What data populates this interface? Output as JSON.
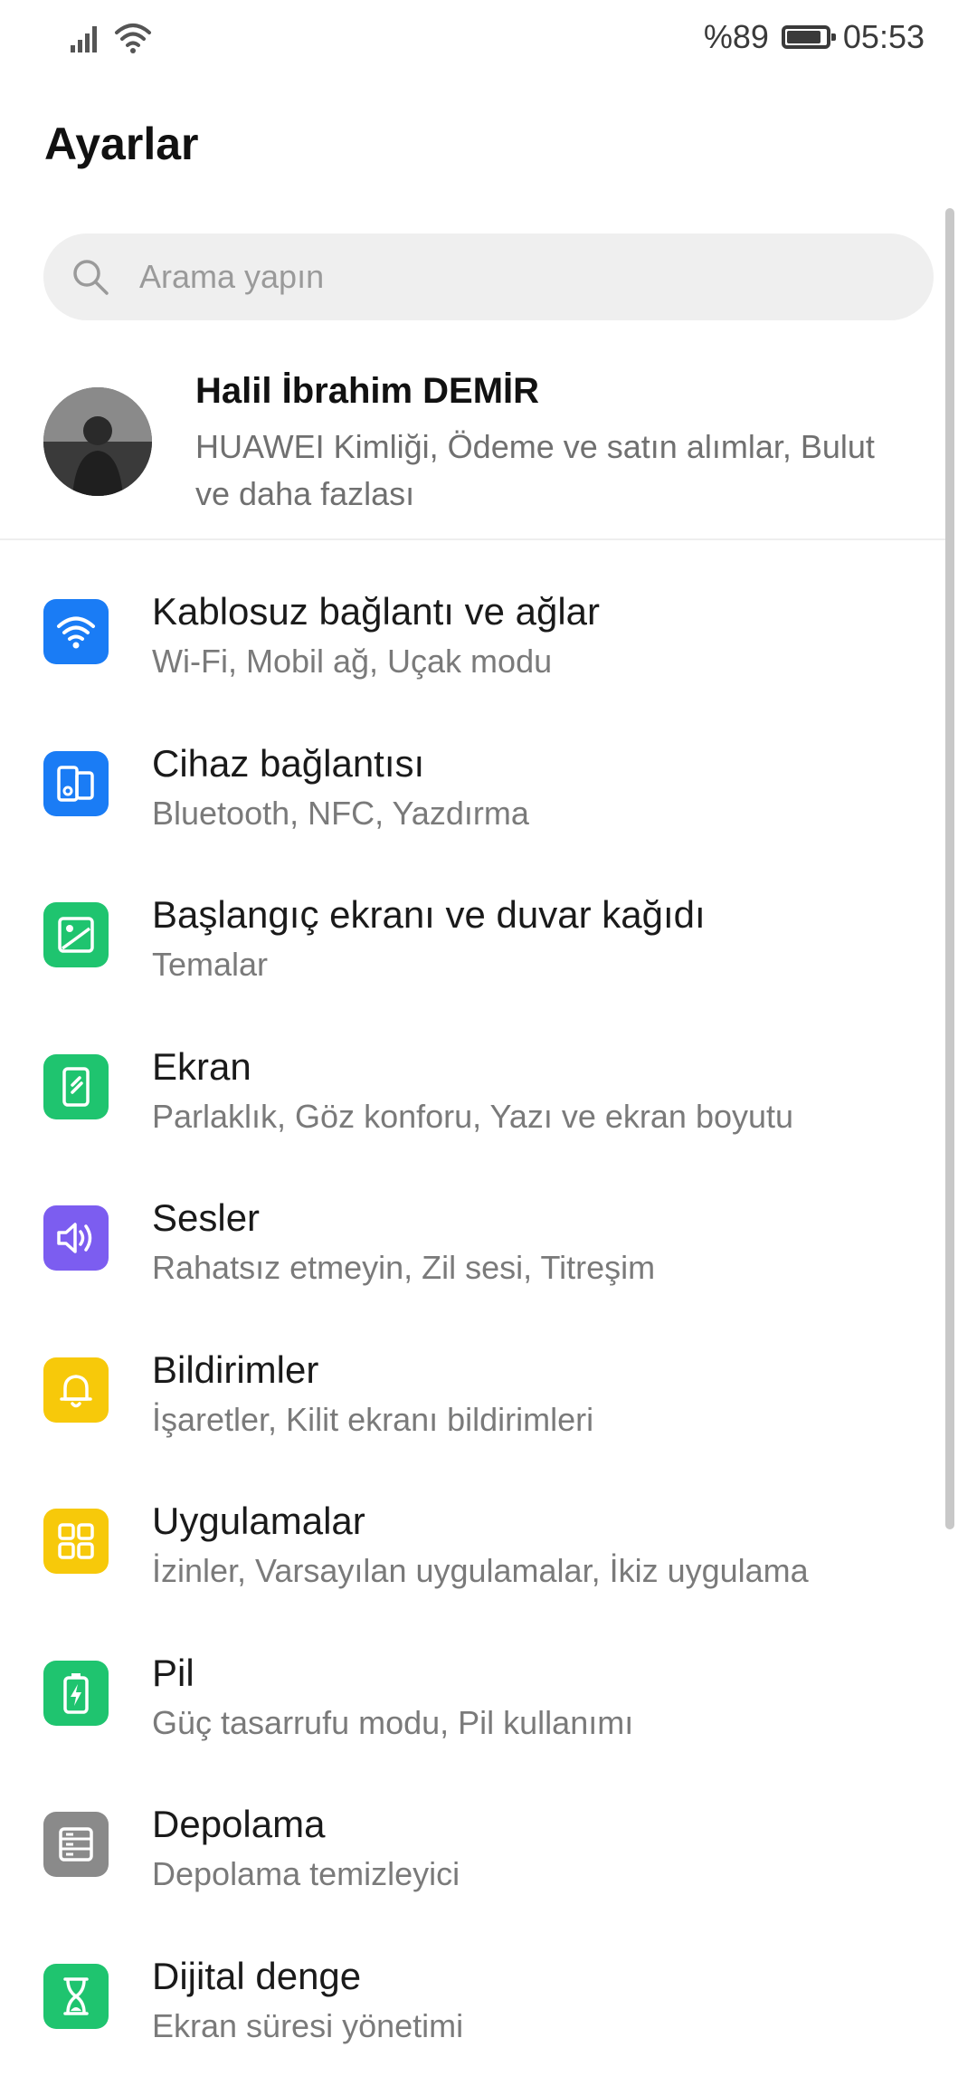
{
  "status_bar": {
    "battery_percent": "%89",
    "time": "05:53",
    "battery_level": 0.89
  },
  "page": {
    "title": "Ayarlar"
  },
  "search": {
    "placeholder": "Arama yapın"
  },
  "profile": {
    "name": "Halil İbrahim DEMİR",
    "description": "HUAWEI Kimliği, Ödeme ve satın alımlar, Bulut ve daha fazlası"
  },
  "settings": [
    {
      "title": "Kablosuz bağlantı ve ağlar",
      "subtitle": "Wi-Fi, Mobil ağ, Uçak modu",
      "icon": "wifi-icon",
      "color": "#1a7cf5"
    },
    {
      "title": "Cihaz bağlantısı",
      "subtitle": "Bluetooth, NFC, Yazdırma",
      "icon": "device-connection-icon",
      "color": "#1a7cf5"
    },
    {
      "title": "Başlangıç ekranı ve duvar kağıdı",
      "subtitle": "Temalar",
      "icon": "wallpaper-icon",
      "color": "#1fc46f"
    },
    {
      "title": "Ekran",
      "subtitle": "Parlaklık, Göz konforu, Yazı ve ekran boyutu",
      "icon": "display-icon",
      "color": "#1fc46f"
    },
    {
      "title": "Sesler",
      "subtitle": "Rahatsız etmeyin, Zil sesi, Titreşim",
      "icon": "sound-icon",
      "color": "#7c5df0"
    },
    {
      "title": "Bildirimler",
      "subtitle": "İşaretler, Kilit ekranı bildirimleri",
      "icon": "bell-icon",
      "color": "#f7c90a"
    },
    {
      "title": "Uygulamalar",
      "subtitle": "İzinler, Varsayılan uygulamalar, İkiz uygulama",
      "icon": "apps-grid-icon",
      "color": "#f7c90a"
    },
    {
      "title": "Pil",
      "subtitle": "Güç tasarrufu modu, Pil kullanımı",
      "icon": "battery-icon",
      "color": "#1fc46f"
    },
    {
      "title": "Depolama",
      "subtitle": "Depolama temizleyici",
      "icon": "storage-icon",
      "color": "#8a8a8a"
    },
    {
      "title": "Dijital denge",
      "subtitle": "Ekran süresi yönetimi",
      "icon": "hourglass-icon",
      "color": "#1fc46f"
    }
  ]
}
